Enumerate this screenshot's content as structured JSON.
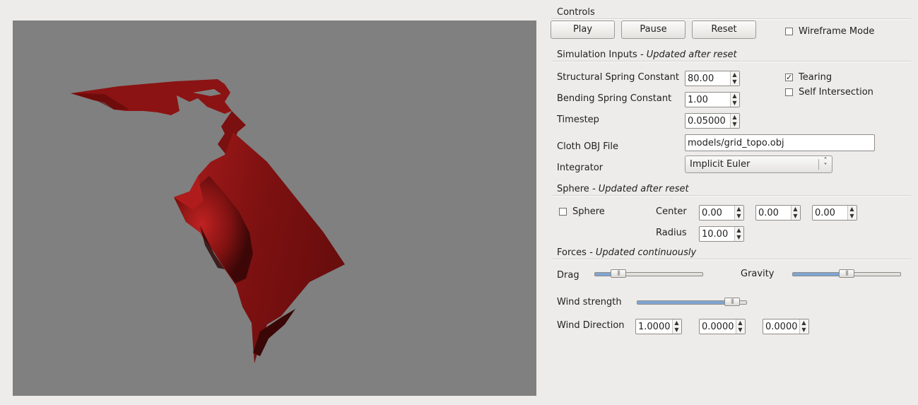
{
  "viewport": {
    "background": "#808080",
    "cloth_color": "#8a1414"
  },
  "controls": {
    "title": "Controls",
    "play_label": "Play",
    "pause_label": "Pause",
    "reset_label": "Reset",
    "wireframe": {
      "label": "Wireframe Mode",
      "checked": false
    }
  },
  "simulation": {
    "title": "Simulation Inputs",
    "note": "- Updated after reset",
    "structural_label": "Structural Spring Constant",
    "structural_value": "80.00",
    "bending_label": "Bending Spring Constant",
    "bending_value": "1.00",
    "timestep_label": "Timestep",
    "timestep_value": "0.05000",
    "tearing": {
      "label": "Tearing",
      "checked": true
    },
    "self_intersection": {
      "label": "Self Intersection",
      "checked": false
    },
    "cloth_file_label": "Cloth OBJ File",
    "cloth_file_value": "models/grid_topo.obj",
    "integrator_label": "Integrator",
    "integrator_value": "Implicit Euler"
  },
  "sphere": {
    "title": "Sphere",
    "note": "- Updated after reset",
    "enabled": {
      "label": "Sphere",
      "checked": false
    },
    "center_label": "Center",
    "center": [
      "0.00",
      "0.00",
      "0.00"
    ],
    "radius_label": "Radius",
    "radius_value": "10.00"
  },
  "forces": {
    "title": "Forces",
    "note": " - Updated continuously",
    "drag_label": "Drag",
    "drag_level": 0.17,
    "gravity_label": "Gravity",
    "gravity_level": 0.5,
    "wind_strength_label": "Wind strength",
    "wind_strength_level": 0.93,
    "wind_direction_label": "Wind Direction",
    "wind_direction": [
      "1.0000",
      "0.0000",
      "0.0000"
    ]
  }
}
